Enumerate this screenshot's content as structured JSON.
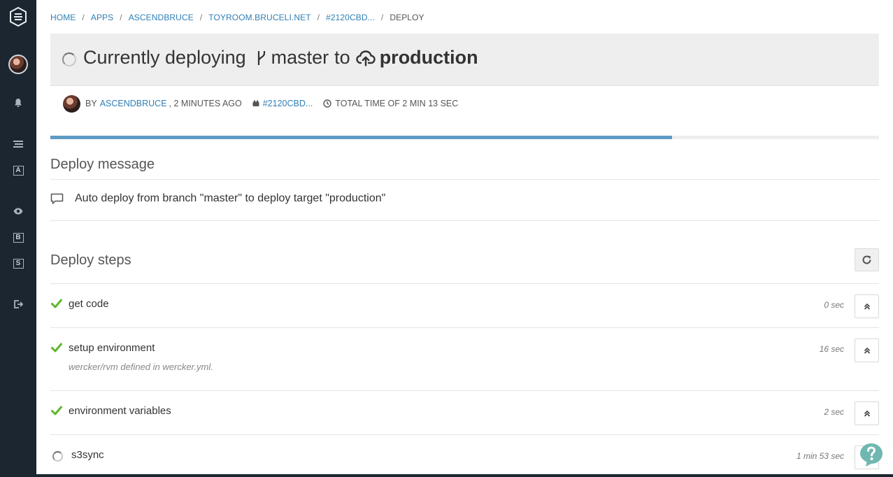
{
  "sidebar": {
    "letters": [
      "A",
      "B",
      "S"
    ]
  },
  "breadcrumb": {
    "items": [
      "HOME",
      "APPS",
      "ASCENDBRUCE",
      "TOYROOM.BRUCELI.NET",
      "#2120CBD..."
    ],
    "current": "DEPLOY",
    "separator": "/"
  },
  "header": {
    "prefix": "Currently deploying",
    "branch": "master",
    "connector": "to",
    "target": "production"
  },
  "meta": {
    "by_label": "BY",
    "author": "ASCENDBRUCE",
    "time_ago": ", 2 MINUTES AGO",
    "commit": "#2120CBD...",
    "total_time": "TOTAL TIME OF 2 MIN 13 SEC"
  },
  "progress": {
    "percent": 75
  },
  "deploy_message": {
    "title": "Deploy message",
    "text": "Auto deploy from branch \"master\" to deploy target \"production\""
  },
  "deploy_steps": {
    "title": "Deploy steps",
    "steps": [
      {
        "name": "get code",
        "time": "0 sec",
        "status": "done",
        "sub": ""
      },
      {
        "name": "setup environment",
        "time": "16 sec",
        "status": "done",
        "sub": "wercker/rvm defined in wercker.yml."
      },
      {
        "name": "environment variables",
        "time": "2 sec",
        "status": "done",
        "sub": ""
      },
      {
        "name": "s3sync",
        "time": "1 min 53 sec",
        "status": "running",
        "sub": ""
      }
    ]
  },
  "colors": {
    "sidebar": "#1b2631",
    "link": "#2f7fb6",
    "progress": "#5e9ac4",
    "success": "#5cb82b",
    "help": "#6fb7b0"
  }
}
